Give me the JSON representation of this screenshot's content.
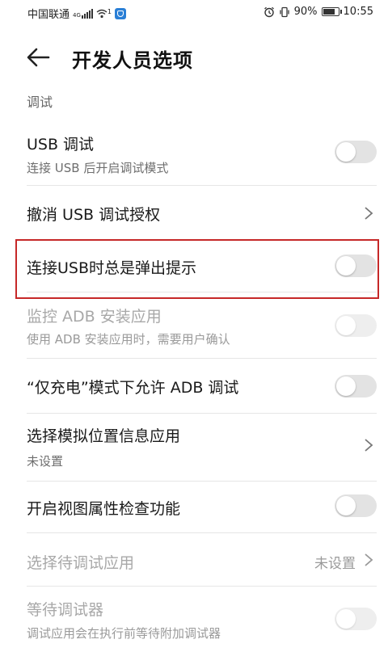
{
  "status_bar": {
    "carrier": "中国联通",
    "network": "4G",
    "wifi_badge": "1",
    "icons": [
      "signal-icon",
      "wifi-icon",
      "shield-app-icon",
      "alarm-icon",
      "vibrate-icon",
      "battery-icon"
    ],
    "battery_percent": "90%",
    "battery_level": 0.9,
    "time": "10:55"
  },
  "header": {
    "title": "开发人员选项",
    "back_icon": "arrow-left-icon"
  },
  "section": {
    "label": "调试"
  },
  "rows": [
    {
      "title": "USB 调试",
      "subtitle": "连接 USB 后开启调试模式",
      "control": "toggle",
      "on": false,
      "enabled": true
    },
    {
      "title": "撤消 USB 调试授权",
      "control": "chevron",
      "enabled": true
    },
    {
      "title": "连接USB时总是弹出提示",
      "control": "toggle",
      "on": false,
      "enabled": true,
      "highlighted": true
    },
    {
      "title": "监控 ADB 安装应用",
      "subtitle": "使用 ADB 安装应用时，需要用户确认",
      "control": "toggle",
      "on": false,
      "enabled": false
    },
    {
      "title": "“仅充电”模式下允许 ADB 调试",
      "control": "toggle",
      "on": false,
      "enabled": true
    },
    {
      "title": "选择模拟位置信息应用",
      "subtitle": "未设置",
      "control": "chevron",
      "enabled": true
    },
    {
      "title": "开启视图属性检查功能",
      "control": "toggle",
      "on": false,
      "enabled": true
    },
    {
      "title": "选择待调试应用",
      "value": "未设置",
      "control": "chevron",
      "enabled": false
    },
    {
      "title": "等待调试器",
      "subtitle": "调试应用会在执行前等待附加调试器",
      "control": "toggle",
      "on": false,
      "enabled": false
    }
  ],
  "colors": {
    "highlight_border": "#c62828",
    "toggle_off": "#e3e3e3",
    "disabled_text": "#a8a8a8"
  }
}
